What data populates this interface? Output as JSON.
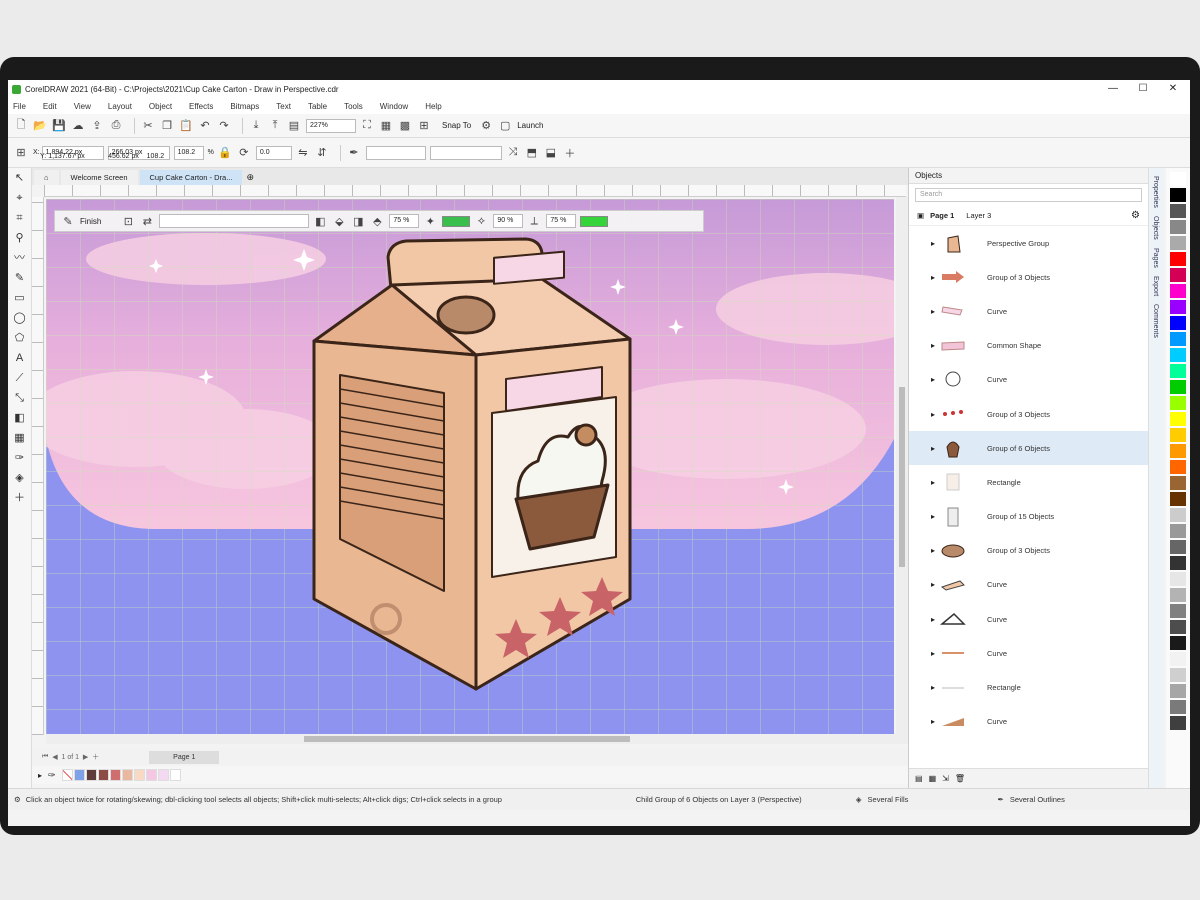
{
  "window": {
    "title": "CorelDRAW 2021 (64-Bit) - C:\\Projects\\2021\\Cup Cake Carton - Draw in Perspective.cdr"
  },
  "menu": [
    "File",
    "Edit",
    "View",
    "Layout",
    "Object",
    "Effects",
    "Bitmaps",
    "Text",
    "Table",
    "Tools",
    "Window",
    "Help"
  ],
  "toolbar": {
    "zoom": "227%",
    "snap_label": "Snap To",
    "launch_label": "Launch"
  },
  "propertybar": {
    "x": "1,894.22 px",
    "y": "1,137.67 px",
    "width": "266.03 px",
    "height": "456.62 px",
    "scale_w": "108.2",
    "scale_h": "108.2",
    "scale_unit": "%",
    "rotation": "0.0"
  },
  "tabs": [
    "Welcome Screen",
    "Cup Cake Carton - Dra..."
  ],
  "perspective_bar": {
    "finish_label": "Finish",
    "pct1": "75 %",
    "pct2": "90 %",
    "pct3": "75 %",
    "color1": "#3bbf4c",
    "color2": "#35d43a"
  },
  "page_nav": {
    "pages": "1 of 1",
    "page_tab": "Page 1"
  },
  "status": {
    "hint": "Click an object twice for rotating/skewing; dbl-clicking tool selects all objects; Shift+click multi-selects; Alt+click digs; Ctrl+click selects in a group",
    "selection": "Child Group of 6 Objects on Layer 3 (Perspective)",
    "fill": "Several Fills",
    "outline": "Several Outlines"
  },
  "objects_panel": {
    "title": "Objects",
    "search_placeholder": "Search",
    "page": "Page 1",
    "layer": "Layer 3",
    "items": [
      {
        "label": "Perspective Group",
        "thumb": "carton"
      },
      {
        "label": "Group of 3 Objects",
        "thumb": "arrow"
      },
      {
        "label": "Curve",
        "thumb": "label"
      },
      {
        "label": "Common Shape",
        "thumb": "banner"
      },
      {
        "label": "Curve",
        "thumb": "cupcake-outline"
      },
      {
        "label": "Group of 3 Objects",
        "thumb": "dots"
      },
      {
        "label": "Group of 6 Objects",
        "thumb": "cupcake",
        "selected": true
      },
      {
        "label": "Rectangle",
        "thumb": "rect"
      },
      {
        "label": "Group of 15 Objects",
        "thumb": "panel"
      },
      {
        "label": "Group of 3 Objects",
        "thumb": "cookie"
      },
      {
        "label": "Curve",
        "thumb": "flap"
      },
      {
        "label": "Curve",
        "thumb": "triangle"
      },
      {
        "label": "Curve",
        "thumb": "line"
      },
      {
        "label": "Rectangle",
        "thumb": "strip"
      },
      {
        "label": "Curve",
        "thumb": "wedge"
      }
    ]
  },
  "docker_tabs": [
    "Properties",
    "Objects",
    "Pages",
    "Export",
    "Comments"
  ],
  "colors": {
    "sky_top": "#c79ad9",
    "sky_mid": "#f2b6d6",
    "ground": "#8e93ef",
    "carton": "#f2c7a6",
    "carton_dark": "#e1aa84",
    "outline": "#3b2418",
    "star": "#c86468",
    "accent": "#cfe3f7"
  },
  "palette": [
    "#ffffff",
    "#7ea1e7",
    "#5e3c3c",
    "#8e4a44",
    "#d06d6d",
    "#e8b8a0",
    "#f7d9c4",
    "#f6c7e2",
    "#f4d9f2",
    "#ffffff"
  ],
  "color_palette": [
    "#ffffff",
    "#000000",
    "#555555",
    "#888888",
    "#aaaaaa",
    "#ff0000",
    "#d40055",
    "#ff00cc",
    "#9900ff",
    "#0000ff",
    "#0099ff",
    "#00ccff",
    "#00ff99",
    "#00cc00",
    "#99ff00",
    "#ffff00",
    "#ffcc00",
    "#ff9900",
    "#ff6600",
    "#996633",
    "#663300",
    "#cccccc",
    "#999999",
    "#666666",
    "#333333",
    "#e6e6e6",
    "#b3b3b3",
    "#808080",
    "#4d4d4d",
    "#1a1a1a",
    "#f2f2f2",
    "#cfcfcf",
    "#a6a6a6",
    "#7a7a7a",
    "#3f3f3f"
  ]
}
